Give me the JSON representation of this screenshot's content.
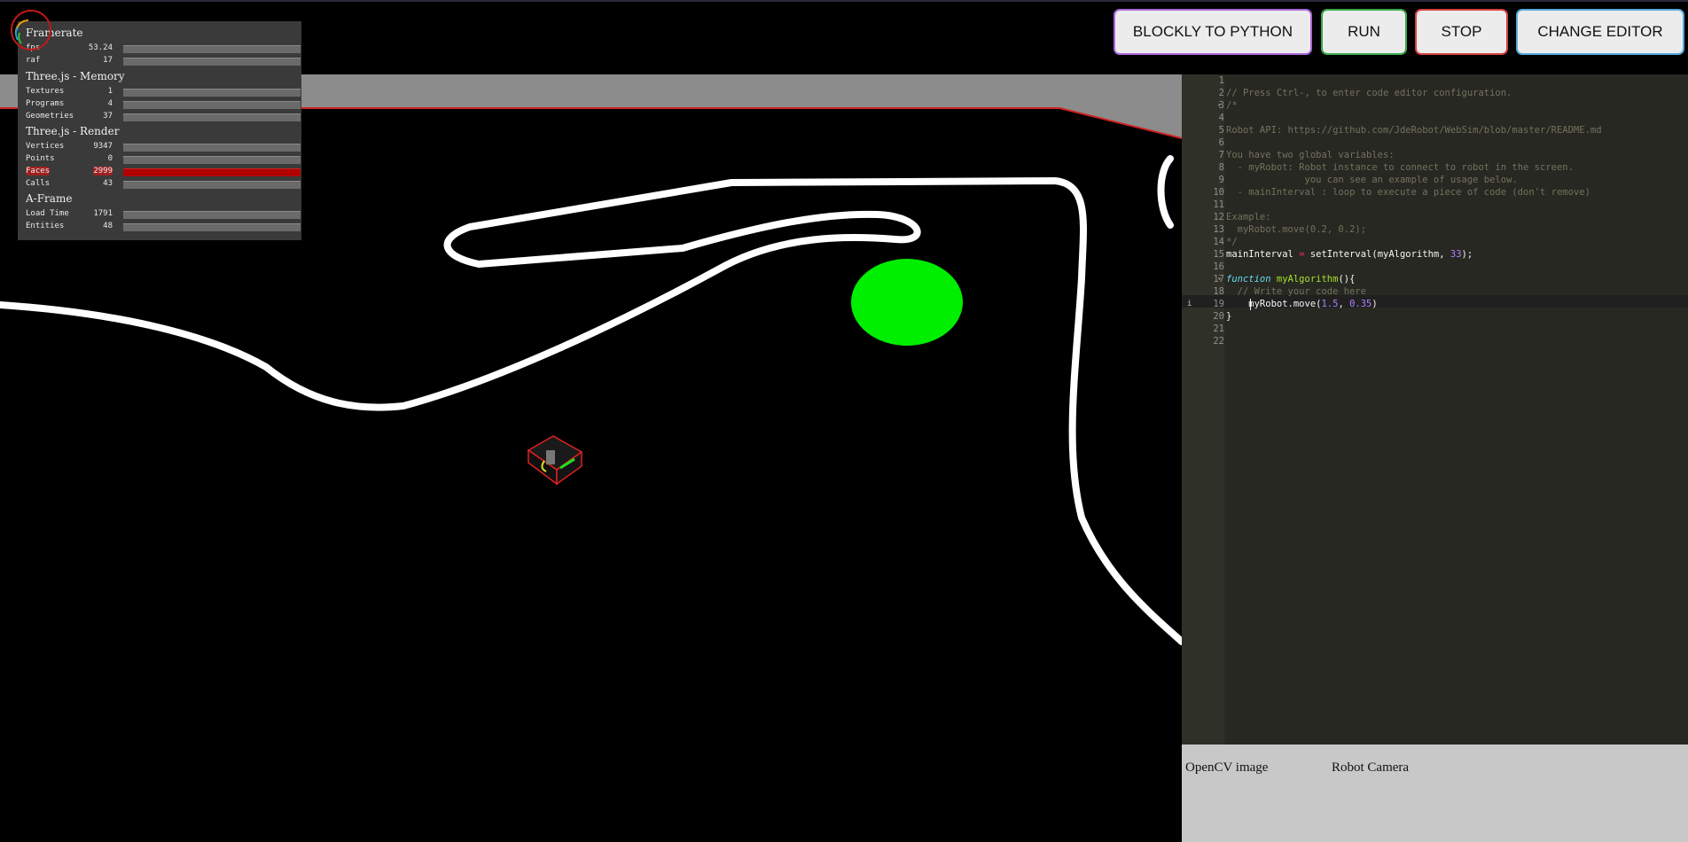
{
  "toolbar": {
    "blockly_label": "BLOCKLY TO PYTHON",
    "run_label": "RUN",
    "stop_label": "STOP",
    "change_label": "CHANGE EDITOR"
  },
  "stats": {
    "framerate_title": "Framerate",
    "fps_label": "fps",
    "fps_value": "53.24",
    "raf_label": "raf",
    "raf_value": "17",
    "memory_title": "Three.js - Memory",
    "textures_label": "Textures",
    "textures_value": "1",
    "programs_label": "Programs",
    "programs_value": "4",
    "geometries_label": "Geometries",
    "geometries_value": "37",
    "render_title": "Three.js - Render",
    "vertices_label": "Vertices",
    "vertices_value": "9347",
    "points_label": "Points",
    "points_value": "0",
    "faces_label": "Faces",
    "faces_value": "2999",
    "calls_label": "Calls",
    "calls_value": "43",
    "aframe_title": "A-Frame",
    "loadtime_label": "Load Time",
    "loadtime_value": "1791",
    "entities_label": "Entities",
    "entities_value": "48"
  },
  "editor": {
    "line_numbers": [
      "1",
      "2",
      "3",
      "4",
      "5",
      "6",
      "7",
      "8",
      "9",
      "10",
      "11",
      "12",
      "13",
      "14",
      "15",
      "16",
      "17",
      "18",
      "19",
      "20",
      "21",
      "22"
    ],
    "lines": {
      "l2": "// Press Ctrl-, to enter code editor configuration.",
      "l3": "/*",
      "l5": "Robot API: https://github.com/JdeRobot/WebSim/blob/master/README.md",
      "l7": "You have two global variables:",
      "l8": "  - myRobot: Robot instance to connect to robot in the screen.",
      "l9": "              you can see an example of usage below.",
      "l10": "  - mainInterval : loop to execute a piece of code (don't remove)",
      "l12": "Example:",
      "l13": "  myRobot.move(0.2, 0.2);",
      "l14": "*/",
      "l15_a": "mainInterval ",
      "l15_op": "=",
      "l15_b": " setInterval(myAlgorithm, ",
      "l15_num": "33",
      "l15_c": ");",
      "l17_kw": "function",
      "l17_fn": " myAlgorithm",
      "l17_rest": "(){",
      "l18": "  // Write your code here",
      "l19_a": "    myRobot.move(",
      "l19_n1": "1.5",
      "l19_b": ", ",
      "l19_n2": "0.35",
      "l19_c": ")",
      "l20": "}"
    }
  },
  "bottom": {
    "opencv_label": "OpenCV image",
    "camera_label": "Robot Camera"
  },
  "colors": {
    "run_border": "#3aa84a",
    "stop_border": "#d84040",
    "blockly_border": "#a868d8",
    "change_border": "#58a8d8",
    "target": "#00ee00"
  }
}
